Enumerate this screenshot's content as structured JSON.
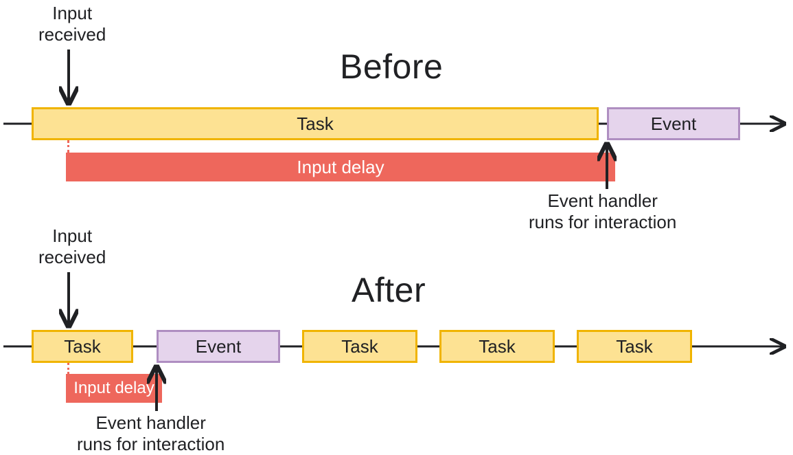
{
  "before": {
    "heading": "Before",
    "input_received": "Input\nreceived",
    "task_label": "Task",
    "event_label": "Event",
    "input_delay_label": "Input delay",
    "handler_caption": "Event handler\nruns for interaction"
  },
  "after": {
    "heading": "After",
    "input_received": "Input\nreceived",
    "task_labels": [
      "Task",
      "Task",
      "Task",
      "Task"
    ],
    "event_label": "Event",
    "input_delay_label": "Input delay",
    "handler_caption": "Event handler\nruns for interaction"
  },
  "colors": {
    "task_fill": "#fde293",
    "task_border": "#f0b400",
    "event_fill": "#e5d4ec",
    "event_border": "#af8ec1",
    "delay_fill": "#ee675c",
    "arrow": "#202124"
  }
}
